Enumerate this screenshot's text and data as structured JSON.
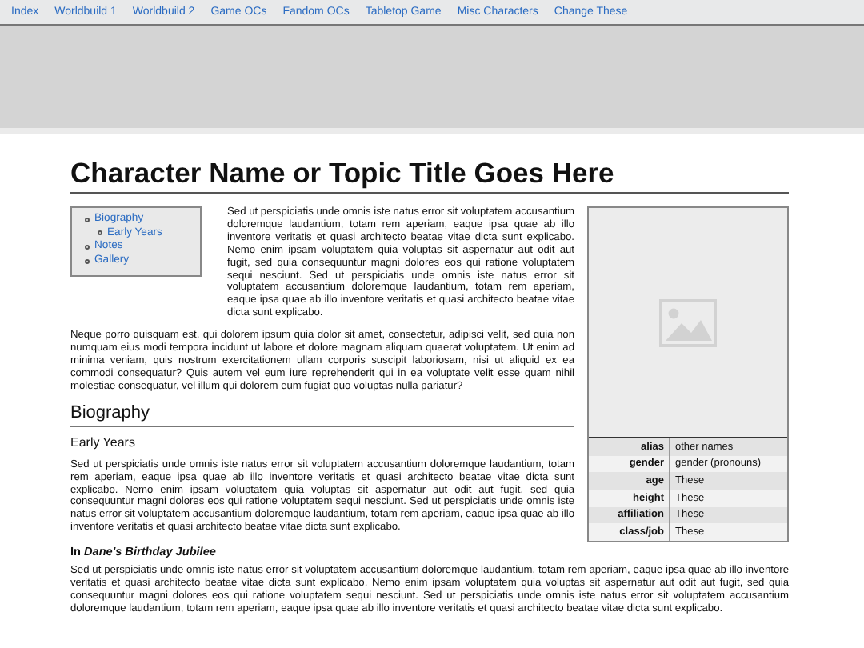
{
  "nav": [
    {
      "label": "Index"
    },
    {
      "label": "Worldbuild 1"
    },
    {
      "label": "Worldbuild 2"
    },
    {
      "label": "Game OCs"
    },
    {
      "label": "Fandom OCs"
    },
    {
      "label": "Tabletop Game"
    },
    {
      "label": "Misc Characters"
    },
    {
      "label": "Change These"
    }
  ],
  "title": "Character Name or Topic Title Goes Here",
  "toc": [
    {
      "label": "Biography",
      "children": [
        {
          "label": "Early Years"
        }
      ]
    },
    {
      "label": "Notes"
    },
    {
      "label": "Gallery"
    }
  ],
  "infobox": {
    "rows": [
      {
        "label": "alias",
        "value": "other names"
      },
      {
        "label": "gender",
        "value": "gender (pronouns)"
      },
      {
        "label": "age",
        "value": "These"
      },
      {
        "label": "height",
        "value": "These"
      },
      {
        "label": "affiliation",
        "value": "These"
      },
      {
        "label": "class/job",
        "value": "These"
      }
    ]
  },
  "blocks": [
    {
      "kind": "paragraph",
      "text": "Sed ut perspiciatis unde omnis iste natus error sit voluptatem accusantium doloremque laudantium, totam rem aperiam, eaque ipsa quae ab illo inventore veritatis et quasi architecto beatae vitae dicta sunt explicabo. Nemo enim ipsam voluptatem quia voluptas sit aspernatur aut odit aut fugit, sed quia consequuntur magni dolores eos qui ratione voluptatem sequi nesciunt. Sed ut perspiciatis unde omnis iste natus error sit voluptatem accusantium doloremque laudantium, totam rem aperiam, eaque ipsa quae ab illo inventore veritatis et quasi architecto beatae vitae dicta sunt explicabo."
    },
    {
      "kind": "paragraph",
      "text": "Neque porro quisquam est, qui dolorem ipsum quia dolor sit amet, consectetur, adipisci velit, sed quia non numquam eius modi tempora incidunt ut labore et dolore magnam aliquam quaerat voluptatem. Ut enim ad minima veniam, quis nostrum exercitationem ullam corporis suscipit laboriosam, nisi ut aliquid ex ea commodi consequatur? Quis autem vel eum iure reprehenderit qui in ea voluptate velit esse quam nihil molestiae consequatur, vel illum qui dolorem eum fugiat quo voluptas nulla pariatur?"
    },
    {
      "kind": "section",
      "text": "Biography"
    },
    {
      "kind": "subsection",
      "text": "Early Years"
    },
    {
      "kind": "paragraph",
      "text": "Sed ut perspiciatis unde omnis iste natus error sit voluptatem accusantium doloremque laudantium, totam rem aperiam, eaque ipsa quae ab illo inventore veritatis et quasi architecto beatae vitae dicta sunt explicabo. Nemo enim ipsam voluptatem quia voluptas sit aspernatur aut odit aut fugit, sed quia consequuntur magni dolores eos qui ratione voluptatem sequi nesciunt. Sed ut perspiciatis unde omnis iste natus error sit voluptatem accusantium doloremque laudantium, totam rem aperiam, eaque ipsa quae ab illo inventore veritatis et quasi architecto beatae vitae dicta sunt explicabo."
    },
    {
      "kind": "minor",
      "text": "In *Dane's Birthday Jubilee*"
    },
    {
      "kind": "paragraph",
      "text": "Sed ut perspiciatis unde omnis iste natus error sit voluptatem accusantium doloremque laudantium, totam rem aperiam, eaque ipsa quae ab illo inventore veritatis et quasi architecto beatae vitae dicta sunt explicabo. Nemo enim ipsam voluptatem quia voluptas sit aspernatur aut odit aut fugit, sed quia consequuntur magni dolores eos qui ratione voluptatem sequi nesciunt. Sed ut perspiciatis unde omnis iste natus error sit voluptatem accusantium doloremque laudantium, totam rem aperiam, eaque ipsa quae ab illo inventore veritatis et quasi architecto beatae vitae dicta sunt explicabo."
    }
  ]
}
